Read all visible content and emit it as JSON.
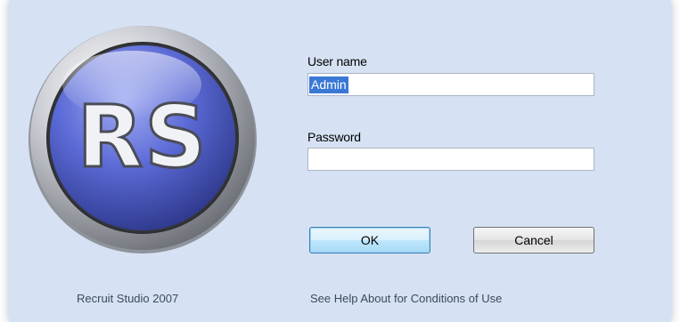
{
  "logo": {
    "text": "RS"
  },
  "login": {
    "username_label": "User name",
    "username_value": "Admin",
    "password_label": "Password",
    "password_value": ""
  },
  "buttons": {
    "ok_label": "OK",
    "cancel_label": "Cancel"
  },
  "footer": {
    "product": "Recruit Studio 2007",
    "notice": "See Help About for Conditions of Use"
  },
  "colors": {
    "dialog_background": "#d6e2f3",
    "logo_blue": "#5b6ad6",
    "selection": "#3a78d6"
  }
}
